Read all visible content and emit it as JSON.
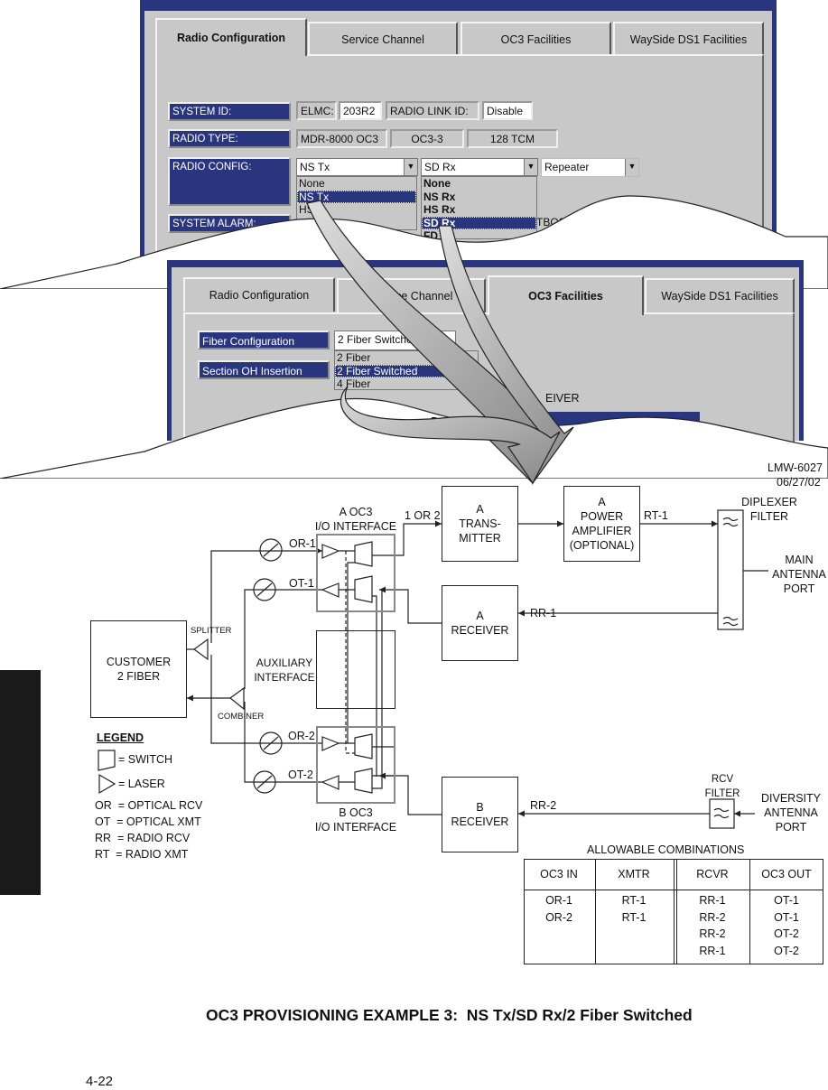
{
  "window1": {
    "tabs": [
      {
        "label": "Radio Configuration",
        "active": true
      },
      {
        "label": "Service Channel"
      },
      {
        "label": "OC3 Facilities"
      },
      {
        "label": "WaySide DS1 Facilities"
      }
    ],
    "system_id_label": "SYSTEM ID:",
    "elmc_label": "ELMC:",
    "elmc_value": "203R2",
    "radio_link_id_label": "RADIO LINK ID:",
    "radio_link_id_value": "Disable",
    "radio_type_label": "RADIO TYPE:",
    "radio_type_values": [
      "MDR-8000 OC3",
      "OC3-3",
      "128 TCM"
    ],
    "radio_config_label": "RADIO CONFIG:",
    "tx_combo": {
      "value": "NS Tx",
      "options": [
        "None",
        "NS Tx",
        "HS"
      ],
      "selected": 1
    },
    "rx_combo": {
      "value": "SD Rx",
      "options": [
        "None",
        "NS Rx",
        "HS Rx",
        "SD Rx",
        "FD Rx"
      ],
      "selected": 3
    },
    "repeater_combo": {
      "value": "Repeater"
    },
    "system_alarm_label": "SYSTEM ALARM:",
    "partial_text": "TBOS"
  },
  "window2": {
    "tabs": [
      {
        "label": "Radio Configuration"
      },
      {
        "label": "Service Channel"
      },
      {
        "label": "OC3 Facilities",
        "active": true
      },
      {
        "label": "WaySide DS1 Facilities"
      }
    ],
    "fiber_config_label": "Fiber Configuration",
    "fiber_combo": {
      "value": "2 Fiber Switched",
      "options": [
        "2 Fiber",
        "2 Fiber Switched",
        "4 Fiber"
      ],
      "selected": 1
    },
    "section_oh_label": "Section OH Insertion",
    "partial_receiver": "EIVER",
    "partial_b": "B"
  },
  "diagram": {
    "doc_id": "LMW-6027",
    "date": "06/27/02",
    "a_oc3": [
      "A OC3",
      "I/O INTERFACE"
    ],
    "b_oc3": [
      "B OC3",
      "I/O INTERFACE"
    ],
    "one_or_two": "1 OR 2",
    "a_transmitter": [
      "A",
      "TRANS-",
      "MITTER"
    ],
    "a_power_amp": [
      "A",
      "POWER",
      "AMPLIFIER",
      "(OPTIONAL)"
    ],
    "rt1": "RT-1",
    "diplexer": [
      "DIPLEXER",
      "FILTER"
    ],
    "main_antenna": [
      "MAIN",
      "ANTENNA",
      "PORT"
    ],
    "a_receiver": [
      "A",
      "RECEIVER"
    ],
    "rr1": "RR-1",
    "b_receiver": [
      "B",
      "RECEIVER"
    ],
    "rr2": "RR-2",
    "rcv_filter": [
      "RCV",
      "FILTER"
    ],
    "diversity": [
      "DIVERSITY",
      "ANTENNA",
      "PORT"
    ],
    "customer": [
      "CUSTOMER",
      "2 FIBER"
    ],
    "splitter": "SPLITTER",
    "combiner": "COMBINER",
    "auxiliary": [
      "AUXILIARY",
      "INTERFACE"
    ],
    "or1": "OR-1",
    "ot1": "OT-1",
    "or2": "OR-2",
    "ot2": "OT-2"
  },
  "legend": {
    "title": "LEGEND",
    "switch": "= SWITCH",
    "laser": "= LASER",
    "defs": [
      "OR  = OPTICAL RCV",
      "OT  = OPTICAL XMT",
      "RR  = RADIO RCV",
      "RT  = RADIO XMT"
    ]
  },
  "combinations": {
    "title": "ALLOWABLE COMBINATIONS",
    "headers": [
      "OC3 IN",
      "XMTR",
      "RCVR",
      "OC3 OUT"
    ],
    "columns": [
      [
        "OR-1",
        "OR-2"
      ],
      [
        "RT-1",
        "RT-1"
      ],
      [
        "RR-1",
        "RR-2",
        "RR-2",
        "RR-1"
      ],
      [
        "OT-1",
        "OT-1",
        "OT-2",
        "OT-2"
      ]
    ]
  },
  "figure_title": "OC3 PROVISIONING EXAMPLE 3:  NS Tx/SD Rx/2 Fiber Switched",
  "page_number": "4-22"
}
